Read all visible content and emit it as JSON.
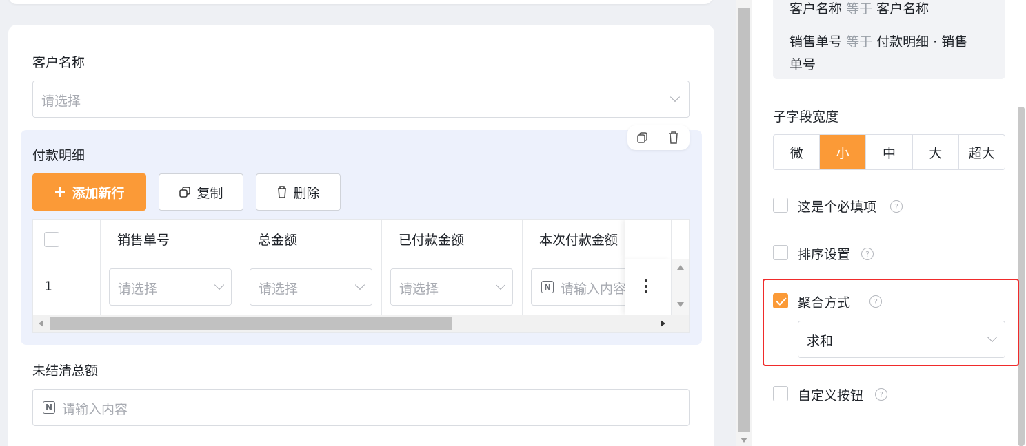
{
  "form": {
    "customer_label": "客户名称",
    "customer_placeholder": "请选择",
    "subform_title": "付款明细",
    "add_row_label": "添加新行",
    "copy_label": "复制",
    "delete_label": "删除",
    "columns": [
      "销售单号",
      "总金额",
      "已付款金额",
      "本次付款金额"
    ],
    "row": {
      "index": "1",
      "select_placeholder": "请选择",
      "input_placeholder": "请输入内容"
    },
    "outstanding_label": "未结清总额",
    "outstanding_placeholder": "请输入内容"
  },
  "right": {
    "conditions": [
      {
        "field": "客户名称",
        "op": "等于",
        "value": "客户名称"
      },
      {
        "field": "销售单号",
        "op": "等于",
        "value": "付款明细 · 销售",
        "value_cont": "单号"
      }
    ],
    "width_title": "子字段宽度",
    "width_options": [
      "微",
      "小",
      "中",
      "大",
      "超大"
    ],
    "width_selected": "小",
    "required_label": "这是个必填项",
    "sort_label": "排序设置",
    "aggregate_label": "聚合方式",
    "aggregate_value": "求和",
    "custom_button_label": "自定义按钮"
  },
  "colors": {
    "accent": "#fb9a37",
    "highlight_frame": "#f02b2b",
    "subform_bg": "#edf1fc"
  },
  "icons": [
    "plus-icon",
    "copy-icon",
    "trash-icon",
    "chevron-down-icon",
    "number-field-icon",
    "more-vertical-icon",
    "help-icon",
    "check-icon"
  ]
}
